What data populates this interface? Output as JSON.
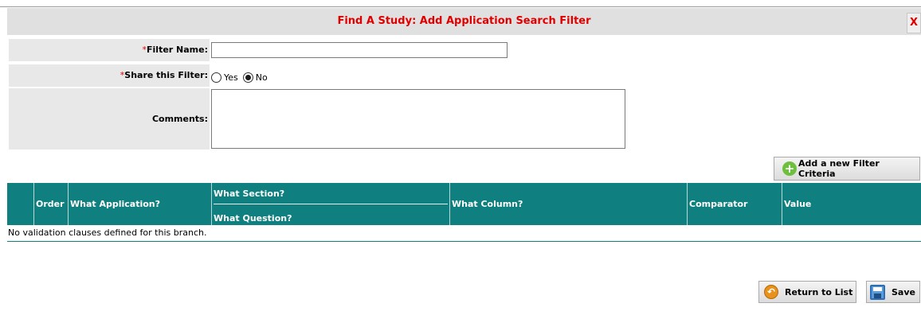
{
  "dialog": {
    "title": "Find A Study: Add Application Search Filter",
    "close_label": "X"
  },
  "form": {
    "required_mark": "*",
    "filter_name_label": "Filter Name:",
    "filter_name_value": "",
    "share_label": "Share this Filter:",
    "share_options": [
      {
        "label": "Yes",
        "checked": false
      },
      {
        "label": "No",
        "checked": true
      }
    ],
    "comments_label": "Comments:",
    "comments_value": ""
  },
  "actions": {
    "add_criteria_label": "Add a new Filter Criteria"
  },
  "grid": {
    "headers": {
      "order": "Order",
      "application": "What Application?",
      "section": "What Section?",
      "question": "What Question?",
      "column": "What Column?",
      "comparator": "Comparator",
      "value": "Value"
    },
    "empty_message": "No validation clauses defined for this branch."
  },
  "footer": {
    "return_label": "Return to List",
    "save_label": "Save"
  },
  "colors": {
    "header_teal": "#0f7f7f",
    "title_red": "#e00000",
    "label_bg": "#e8e8e8",
    "add_icon_green": "#6fbf3e"
  }
}
